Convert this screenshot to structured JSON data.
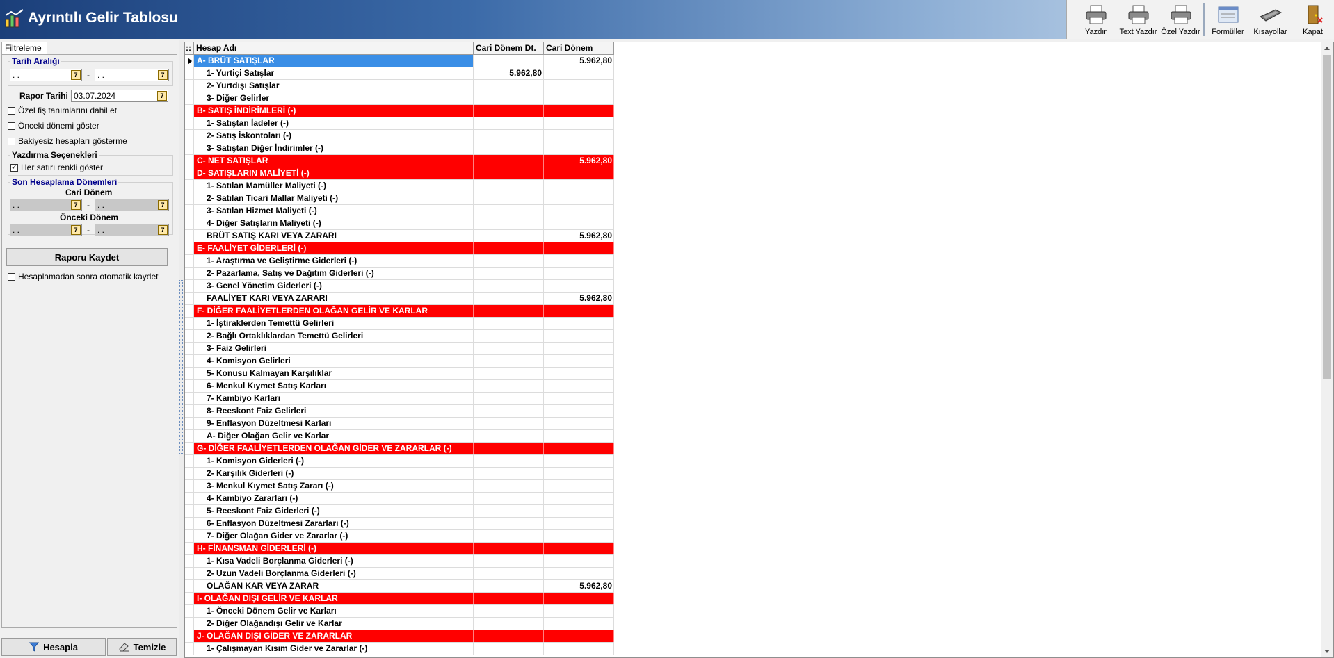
{
  "window": {
    "title": "Ayrıntılı Gelir Tablosu"
  },
  "toolbar": {
    "print": "Yazdır",
    "text_print": "Text Yazdır",
    "custom_print": "Özel Yazdır",
    "formulas": "Formüller",
    "shortcuts": "Kısayollar",
    "close": "Kapat"
  },
  "filter": {
    "tab_label": "Filtreleme",
    "date_range_title": "Tarih Aralığı",
    "date_start": " .  .",
    "date_end": " .  .",
    "dash": "-",
    "report_date_label": "Rapor Tarihi",
    "report_date": "03.07.2024",
    "chk_custom_fis": "Özel fiş tanımlarını dahil et",
    "chk_prev_period": "Önceki dönemi göster",
    "chk_no_balance": "Bakiyesiz hesapları gösterme",
    "print_options_title": "Yazdırma Seçenekleri",
    "chk_colored_rows": "Her satırı renkli göster",
    "chk_colored_rows_checked": true,
    "last_calc_title": "Son Hesaplama Dönemleri",
    "current_period_label": "Cari Dönem",
    "current_start": " .  .",
    "current_end": " .  .",
    "prev_period_label": "Önceki Dönem",
    "prev_start": " .  .",
    "prev_end": " .  .",
    "save_report": "Raporu Kaydet",
    "chk_autosave": "Hesaplamadan sonra otomatik kaydet",
    "calculate": "Hesapla",
    "clear": "Temizle"
  },
  "grid": {
    "columns": [
      "::",
      "Hesap Adı",
      "Cari Dönem Dt.",
      "Cari Dönem"
    ],
    "rows": [
      {
        "type": "sel",
        "name": "A-  BRÜT SATIŞLAR",
        "dt": "",
        "cd": "5.962,80"
      },
      {
        "type": "sub",
        "name": "1- Yurtiçi Satışlar",
        "dt": "5.962,80",
        "cd": ""
      },
      {
        "type": "sub",
        "name": "2- Yurtdışı Satışlar",
        "dt": "",
        "cd": ""
      },
      {
        "type": "sub",
        "name": "3- Diğer Gelirler",
        "dt": "",
        "cd": ""
      },
      {
        "type": "hdr",
        "name": "B-  SATIŞ İNDİRİMLERİ (-)",
        "dt": "",
        "cd": ""
      },
      {
        "type": "sub",
        "name": "1- Satıştan İadeler (-)",
        "dt": "",
        "cd": ""
      },
      {
        "type": "sub",
        "name": "2- Satış İskontoları (-)",
        "dt": "",
        "cd": ""
      },
      {
        "type": "sub",
        "name": "3- Satıştan Diğer İndirimler (-)",
        "dt": "",
        "cd": ""
      },
      {
        "type": "hdr",
        "name": "C-  NET SATIŞLAR",
        "dt": "",
        "cd": "5.962,80"
      },
      {
        "type": "hdr",
        "name": "D-  SATIŞLARIN MALİYETİ (-)",
        "dt": "",
        "cd": ""
      },
      {
        "type": "sub",
        "name": "1- Satılan Mamüller Maliyeti (-)",
        "dt": "",
        "cd": ""
      },
      {
        "type": "sub",
        "name": "2- Satılan Ticari Mallar Maliyeti (-)",
        "dt": "",
        "cd": ""
      },
      {
        "type": "sub",
        "name": "3- Satılan Hizmet Maliyeti (-)",
        "dt": "",
        "cd": ""
      },
      {
        "type": "sub",
        "name": "4- Diğer Satışların Maliyeti (-)",
        "dt": "",
        "cd": ""
      },
      {
        "type": "tot",
        "name": "BRÜT SATIŞ KARI VEYA ZARARI",
        "dt": "",
        "cd": "5.962,80"
      },
      {
        "type": "hdr",
        "name": "E-  FAALİYET GİDERLERİ (-)",
        "dt": "",
        "cd": ""
      },
      {
        "type": "sub",
        "name": "1- Araştırma ve Geliştirme Giderleri (-)",
        "dt": "",
        "cd": ""
      },
      {
        "type": "sub",
        "name": "2- Pazarlama, Satış ve Dağıtım Giderleri (-)",
        "dt": "",
        "cd": ""
      },
      {
        "type": "sub",
        "name": "3- Genel Yönetim Giderleri (-)",
        "dt": "",
        "cd": ""
      },
      {
        "type": "tot",
        "name": "FAALİYET KARI VEYA ZARARI",
        "dt": "",
        "cd": "5.962,80"
      },
      {
        "type": "hdr",
        "name": "F-  DİĞER FAALİYETLERDEN OLAĞAN GELİR VE KARLAR",
        "dt": "",
        "cd": ""
      },
      {
        "type": "sub",
        "name": "1- İştiraklerden Temettü Gelirleri",
        "dt": "",
        "cd": ""
      },
      {
        "type": "sub",
        "name": "2- Bağlı Ortaklıklardan Temettü Gelirleri",
        "dt": "",
        "cd": ""
      },
      {
        "type": "sub",
        "name": "3- Faiz Gelirleri",
        "dt": "",
        "cd": ""
      },
      {
        "type": "sub",
        "name": "4- Komisyon Gelirleri",
        "dt": "",
        "cd": ""
      },
      {
        "type": "sub",
        "name": "5- Konusu Kalmayan Karşılıklar",
        "dt": "",
        "cd": ""
      },
      {
        "type": "sub",
        "name": "6- Menkul Kıymet Satış Karları",
        "dt": "",
        "cd": ""
      },
      {
        "type": "sub",
        "name": "7- Kambiyo Karları",
        "dt": "",
        "cd": ""
      },
      {
        "type": "sub",
        "name": "8- Reeskont Faiz Gelirleri",
        "dt": "",
        "cd": ""
      },
      {
        "type": "sub",
        "name": "9- Enflasyon Düzeltmesi Karları",
        "dt": "",
        "cd": ""
      },
      {
        "type": "sub",
        "name": "A- Diğer Olağan Gelir ve Karlar",
        "dt": "",
        "cd": ""
      },
      {
        "type": "hdr",
        "name": "G-  DİĞER FAALİYETLERDEN OLAĞAN GİDER VE ZARARLAR (-)",
        "dt": "",
        "cd": ""
      },
      {
        "type": "sub",
        "name": "1- Komisyon Giderleri (-)",
        "dt": "",
        "cd": ""
      },
      {
        "type": "sub",
        "name": "2- Karşılık Giderleri (-)",
        "dt": "",
        "cd": ""
      },
      {
        "type": "sub",
        "name": "3- Menkul Kıymet Satış Zararı (-)",
        "dt": "",
        "cd": ""
      },
      {
        "type": "sub",
        "name": "4- Kambiyo Zararları (-)",
        "dt": "",
        "cd": ""
      },
      {
        "type": "sub",
        "name": "5- Reeskont Faiz Giderleri (-)",
        "dt": "",
        "cd": ""
      },
      {
        "type": "sub",
        "name": "6- Enflasyon Düzeltmesi Zararları (-)",
        "dt": "",
        "cd": ""
      },
      {
        "type": "sub",
        "name": "7- Diğer Olağan Gider ve Zararlar (-)",
        "dt": "",
        "cd": ""
      },
      {
        "type": "hdr",
        "name": "H-  FİNANSMAN GİDERLERİ (-)",
        "dt": "",
        "cd": ""
      },
      {
        "type": "sub",
        "name": "1- Kısa Vadeli Borçlanma Giderleri (-)",
        "dt": "",
        "cd": ""
      },
      {
        "type": "sub",
        "name": "2- Uzun Vadeli Borçlanma Giderleri (-)",
        "dt": "",
        "cd": ""
      },
      {
        "type": "tot",
        "name": "OLAĞAN KAR VEYA ZARAR",
        "dt": "",
        "cd": "5.962,80"
      },
      {
        "type": "hdr",
        "name": "I-  OLAĞAN DIŞI GELİR VE KARLAR",
        "dt": "",
        "cd": ""
      },
      {
        "type": "sub",
        "name": "1- Önceki Dönem Gelir ve Karları",
        "dt": "",
        "cd": ""
      },
      {
        "type": "sub",
        "name": "2- Diğer Olağandışı Gelir ve Karlar",
        "dt": "",
        "cd": ""
      },
      {
        "type": "hdr",
        "name": "J-  OLAĞAN DIŞI GİDER VE ZARARLAR",
        "dt": "",
        "cd": ""
      },
      {
        "type": "sub",
        "name": "1- Çalışmayan Kısım Gider ve Zararlar (-)",
        "dt": "",
        "cd": ""
      }
    ]
  },
  "icons": {
    "app": "chart-app-icon",
    "print": "printer-icon",
    "formulas": "formula-window-icon",
    "shortcuts": "keyboard-icon",
    "close": "door-exit-icon",
    "calculate": "funnel-icon",
    "clear": "eraser-icon"
  },
  "colors": {
    "header_row": "#ff0000",
    "selected_row": "#3a8ee6",
    "title_bar": "#1b3f7a"
  }
}
